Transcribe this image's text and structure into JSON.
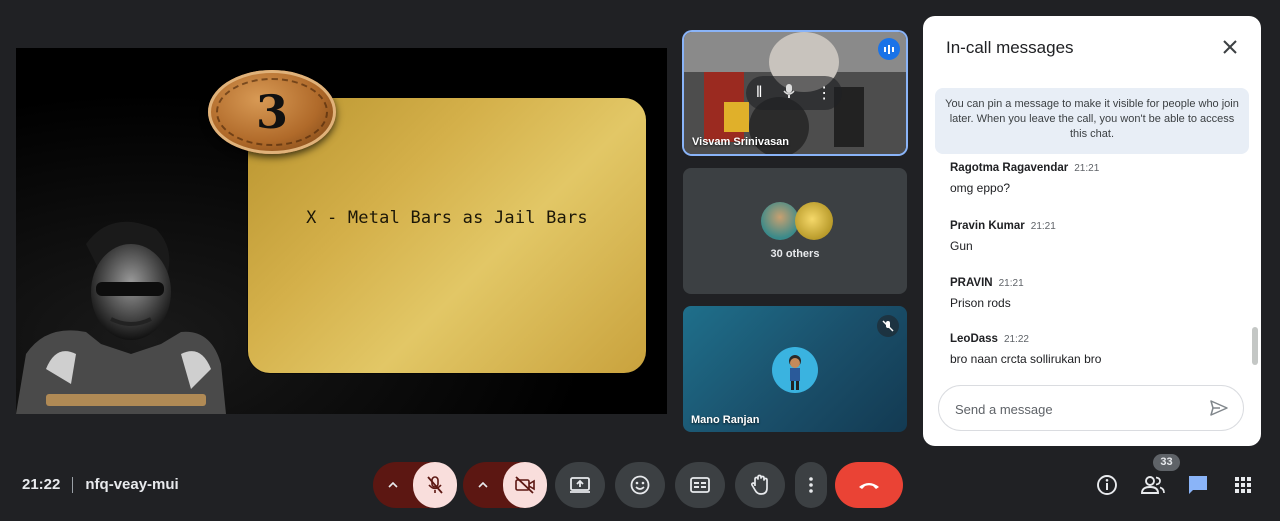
{
  "presentation": {
    "badge_number": "3",
    "slide_text": "X - Metal Bars as Jail Bars"
  },
  "tiles": [
    {
      "name": "Visvam Srinivasan",
      "speaking": true
    },
    {
      "label": "30 others"
    },
    {
      "name": "Mano Ranjan",
      "muted": true
    }
  ],
  "chat": {
    "title": "In-call messages",
    "pin_info": "You can pin a message to make it visible for people who join later. When you leave the call, you won't be able to access this chat.",
    "messages": [
      {
        "sender": "Ragotma Ragavendar",
        "time": "21:21",
        "text": "omg eppo?"
      },
      {
        "sender": "Pravin Kumar",
        "time": "21:21",
        "text": "Gun"
      },
      {
        "sender": "PRAVIN",
        "time": "21:21",
        "text": "Prison rods"
      },
      {
        "sender": "LeoDass",
        "time": "21:22",
        "text": "bro naan crcta sollirukan bro"
      }
    ],
    "input_placeholder": "Send a message"
  },
  "meeting": {
    "time": "21:22",
    "code": "nfq-veay-mui"
  },
  "participants_count": "33",
  "colors": {
    "background": "#202124",
    "accent": "#8ab4f8",
    "hangup": "#ea4335",
    "muted_control": "#5c1712"
  },
  "icons": [
    "speaker-active-icon",
    "mic-off-icon",
    "camera-off-icon",
    "present-icon",
    "emoji-icon",
    "captions-icon",
    "raise-hand-icon",
    "more-vert-icon",
    "call-end-icon",
    "info-icon",
    "people-icon",
    "chat-icon",
    "apps-icon",
    "close-icon",
    "send-icon"
  ]
}
